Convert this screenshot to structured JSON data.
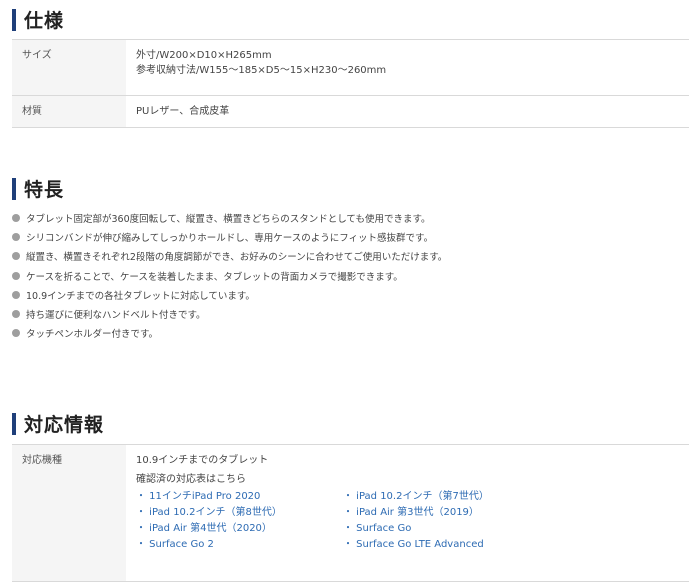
{
  "spec": {
    "title": "仕様",
    "rows": [
      {
        "label": "サイズ",
        "lines": [
          "外寸/W200×D10×H265mm",
          "参考収納寸法/W155～185×D5～15×H230～260mm"
        ]
      },
      {
        "label": "材質",
        "lines": [
          "PUレザー、合成皮革"
        ]
      }
    ]
  },
  "features": {
    "title": "特長",
    "items": [
      "タブレット固定部が360度回転して、縦置き、横置きどちらのスタンドとしても使用できます。",
      "シリコンバンドが伸び縮みしてしっかりホールドし、専用ケースのようにフィット感抜群です。",
      "縦置き、横置きそれぞれ2段階の角度調節ができ、お好みのシーンに合わせてご使用いただけます。",
      "ケースを折ることで、ケースを装着したまま、タブレットの背面カメラで撮影できます。",
      "10.9インチまでの各社タブレットに対応しています。",
      "持ち運びに便利なハンドベルト付きです。",
      "タッチペンホルダー付きです。"
    ]
  },
  "compat": {
    "title": "対応情報",
    "label": "対応機種",
    "summary": "10.9インチまでのタブレット",
    "list_heading": "確認済の対応表はこちら",
    "models": [
      "・ 11インチiPad Pro 2020",
      "・ iPad 10.2インチ（第7世代）",
      "・ iPad 10.2インチ（第8世代）",
      "・ iPad Air 第3世代（2019）",
      "・ iPad Air 第4世代（2020）",
      "・ Surface Go",
      "・ Surface Go 2",
      "・ Surface Go LTE Advanced"
    ]
  }
}
